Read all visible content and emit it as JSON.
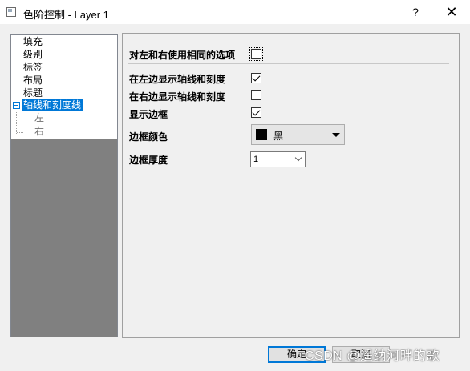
{
  "window": {
    "title": "色阶控制 - Layer 1",
    "help_label": "?",
    "close_label": "✕"
  },
  "tree": {
    "items": [
      {
        "label": "填充"
      },
      {
        "label": "级别"
      },
      {
        "label": "标签"
      },
      {
        "label": "布局"
      },
      {
        "label": "标题"
      },
      {
        "label": "轴线和刻度线",
        "selected": true
      }
    ],
    "children": [
      {
        "label": "左"
      },
      {
        "label": "右"
      }
    ]
  },
  "panel": {
    "same_options_label": "对左和右使用相同的选项",
    "same_options_checked": false,
    "show_left_label": "在左边显示轴线和刻度",
    "show_left_checked": true,
    "show_right_label": "在右边显示轴线和刻度",
    "show_right_checked": false,
    "show_border_label": "显示边框",
    "show_border_checked": true,
    "border_color_label": "边框颜色",
    "border_color_value": "黑",
    "border_color_hex": "#000000",
    "border_thickness_label": "边框厚度",
    "border_thickness_value": "1"
  },
  "buttons": {
    "ok_label": "确定",
    "cancel_label": "取消"
  },
  "watermark": "CSDN @遥纳河畔的歌"
}
